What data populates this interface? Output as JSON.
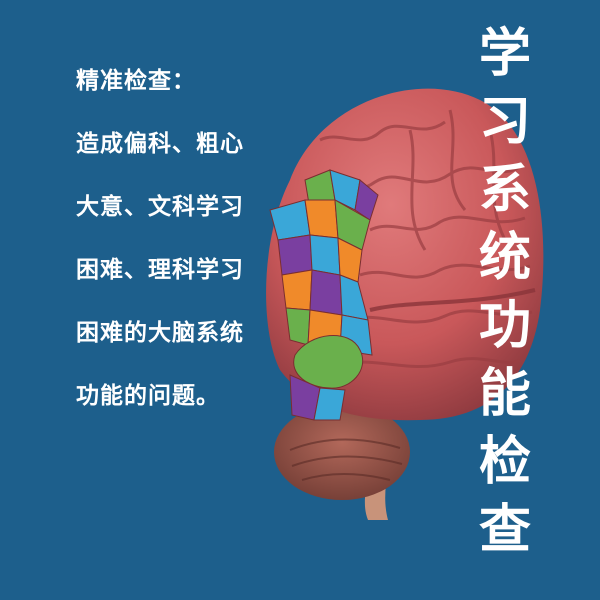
{
  "left_text": {
    "lines": [
      "精准检查：",
      "造成偏科、粗心",
      "大意、文科学习",
      "困难、理科学习",
      "困难的大脑系统",
      "功能的问题。"
    ]
  },
  "vertical_title": {
    "chars": [
      "学",
      "习",
      "系",
      "统",
      "功",
      "能",
      "检",
      "查"
    ]
  },
  "illustration": {
    "icon": "brain-illustration",
    "brain_color": "#c9585a",
    "region_colors": [
      "#f08a2a",
      "#6ab04c",
      "#3aa7d8",
      "#7a3fa0"
    ]
  }
}
